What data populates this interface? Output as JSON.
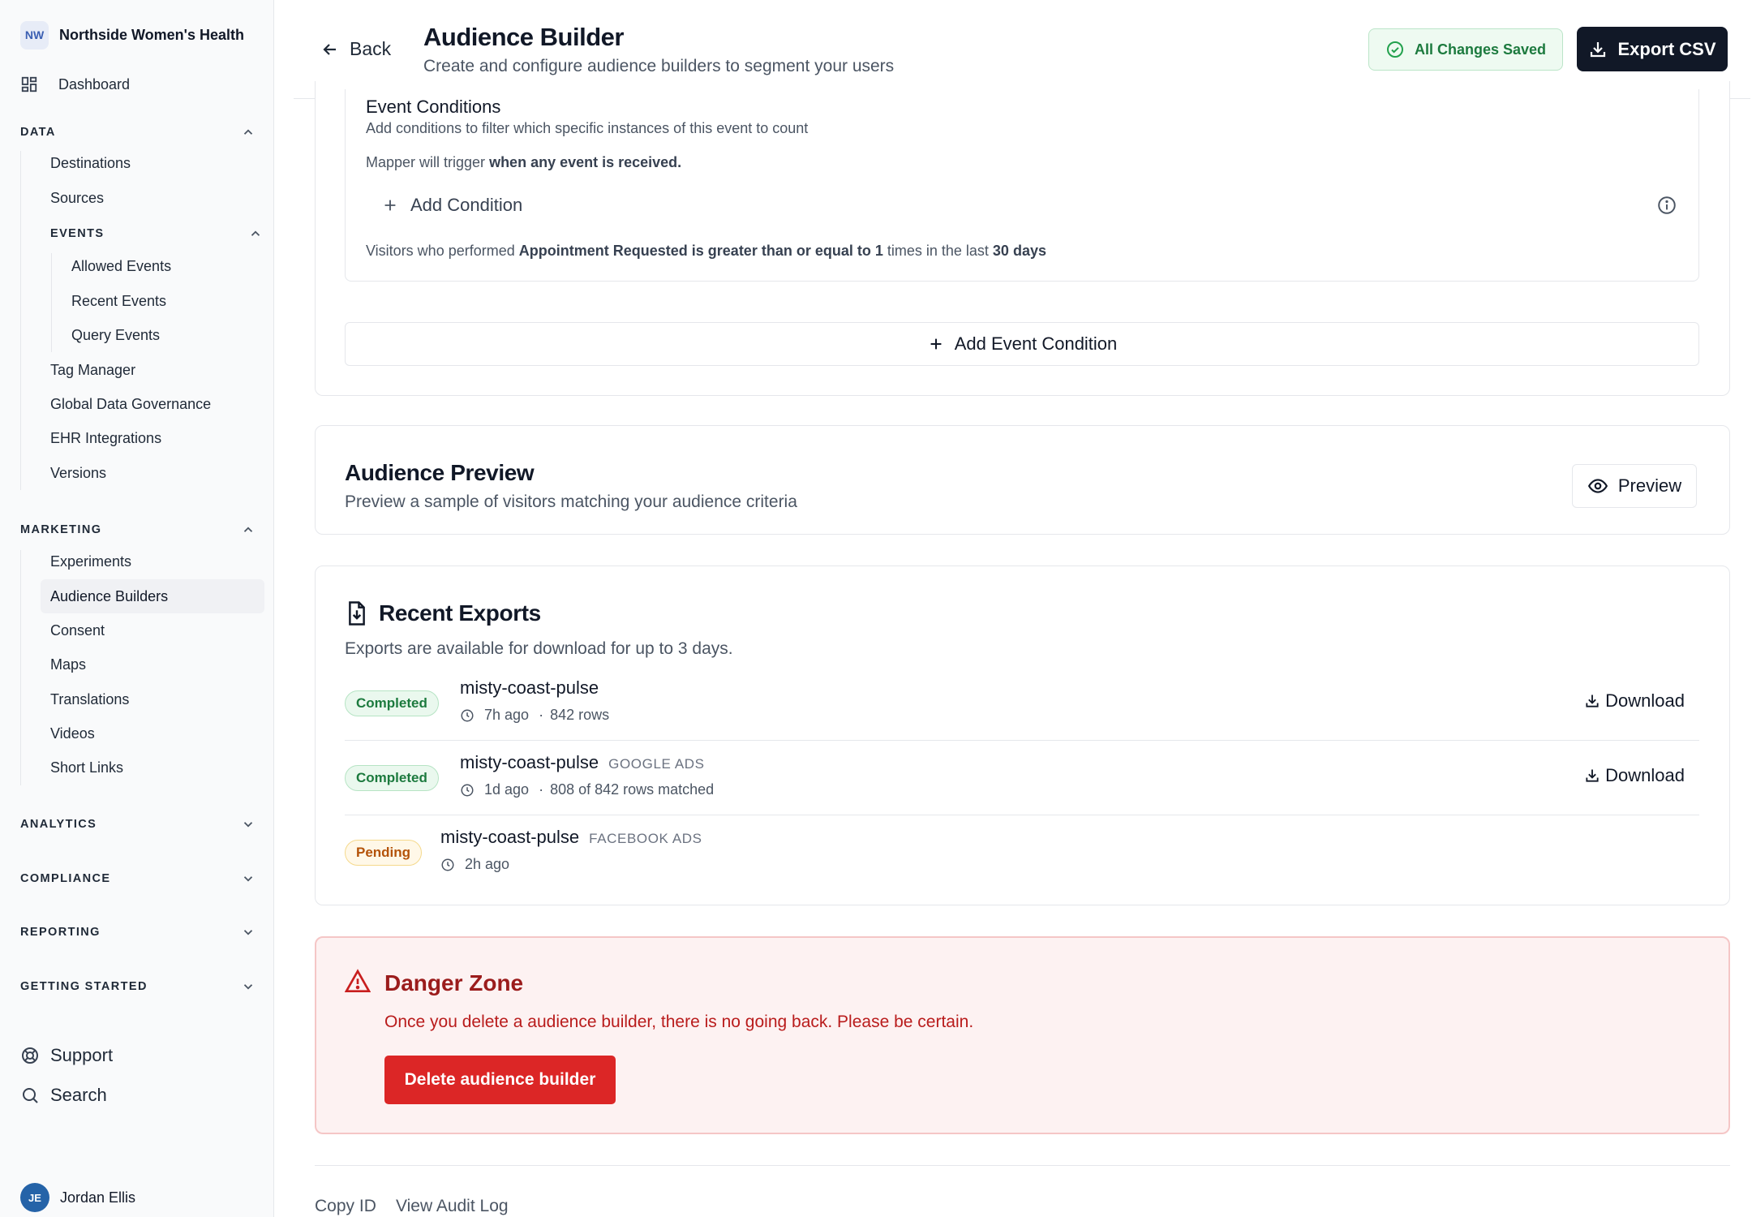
{
  "sidebar": {
    "org_initials": "NW",
    "org_name": "Northside Women's Health",
    "dashboard": "Dashboard",
    "data_section": {
      "label": "DATA",
      "items": [
        "Destinations",
        "Sources"
      ],
      "events": {
        "label": "EVENTS",
        "items": [
          "Allowed Events",
          "Recent Events",
          "Query Events"
        ]
      },
      "items_after": [
        "Tag Manager",
        "Global Data Governance",
        "EHR Integrations",
        "Versions"
      ]
    },
    "marketing_section": {
      "label": "MARKETING",
      "items": [
        "Experiments",
        "Audience Builders",
        "Consent",
        "Maps",
        "Translations",
        "Videos",
        "Short Links"
      ],
      "active": "Audience Builders"
    },
    "collapsed_sections": [
      "ANALYTICS",
      "COMPLIANCE",
      "REPORTING",
      "GETTING STARTED"
    ],
    "support": "Support",
    "search": "Search",
    "user": {
      "initials": "JE",
      "name": "Jordan Ellis"
    }
  },
  "header": {
    "back": "Back",
    "title": "Audience Builder",
    "subtitle": "Create and configure audience builders to segment your users",
    "saved_status": "All Changes Saved",
    "export": "Export CSV"
  },
  "event_conditions": {
    "title": "Event Conditions",
    "description": "Add conditions to filter which specific instances of this event to count",
    "mapper_prefix": "Mapper will trigger ",
    "mapper_bold": "when any event is received.",
    "add_condition": "Add Condition",
    "summary": {
      "t1": "Visitors who performed ",
      "b1": "Appointment Requested",
      "t2": " ",
      "b2": "is greater than or equal to",
      "t3": " ",
      "b3": "1",
      "t4": " times in the last ",
      "b4": "30 days"
    },
    "add_event_condition": "Add Event Condition"
  },
  "audience_preview": {
    "title": "Audience Preview",
    "subtitle": "Preview a sample of visitors matching your audience criteria",
    "button": "Preview"
  },
  "recent_exports": {
    "title": "Recent Exports",
    "subtitle": "Exports are available for download for up to 3 days.",
    "download_label": "Download",
    "rows": [
      {
        "status": "Completed",
        "name": "misty-coast-pulse",
        "destination": "",
        "time": "7h ago",
        "detail": "842 rows"
      },
      {
        "status": "Completed",
        "name": "misty-coast-pulse",
        "destination": "GOOGLE ADS",
        "time": "1d ago",
        "detail": "808 of 842 rows matched"
      },
      {
        "status": "Pending",
        "name": "misty-coast-pulse",
        "destination": "FACEBOOK ADS",
        "time": "2h ago",
        "detail": ""
      }
    ]
  },
  "danger_zone": {
    "title": "Danger Zone",
    "text": "Once you delete a audience builder, there is no going back. Please be certain.",
    "button": "Delete audience builder"
  },
  "footer": {
    "copy_id": "Copy ID",
    "audit_log": "View Audit Log"
  },
  "colors": {
    "brand_dark": "#111827",
    "success": "#1c7a3e",
    "danger": "#dc2626",
    "pending": "#b45309"
  },
  "icons": [
    "dashboard-icon",
    "chevron-up-icon",
    "chevron-down-icon",
    "support-icon",
    "search-icon",
    "arrow-left-icon",
    "check-circle-icon",
    "download-icon",
    "plus-icon",
    "info-icon",
    "eye-icon",
    "file-download-icon",
    "clock-icon",
    "warning-triangle-icon"
  ]
}
